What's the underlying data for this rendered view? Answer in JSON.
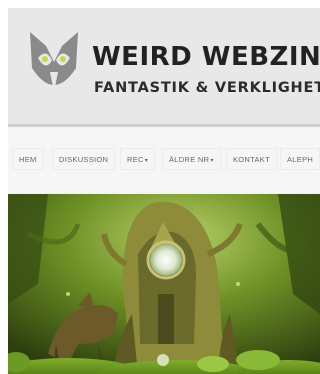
{
  "header": {
    "title": "WEIRD WEBZINE",
    "tagline": "FANTASTIK & VERKLIGHET",
    "logo_icon": "owl-logo-icon"
  },
  "nav": {
    "items": [
      {
        "label": "HEM",
        "caret": ""
      },
      {
        "label": "DISKUSSION",
        "caret": ""
      },
      {
        "label": "REC",
        "caret": "▾"
      },
      {
        "label": "ÄLDRE NR",
        "caret": "▾"
      },
      {
        "label": "KONTAKT",
        "caret": ""
      },
      {
        "label": "ALEPH",
        "caret": ""
      }
    ]
  },
  "colors": {
    "header_bg": "#e8e8e8",
    "nav_bg": "#f6f6f6",
    "title": "#222222",
    "hero_green": "#5d8a1c"
  }
}
